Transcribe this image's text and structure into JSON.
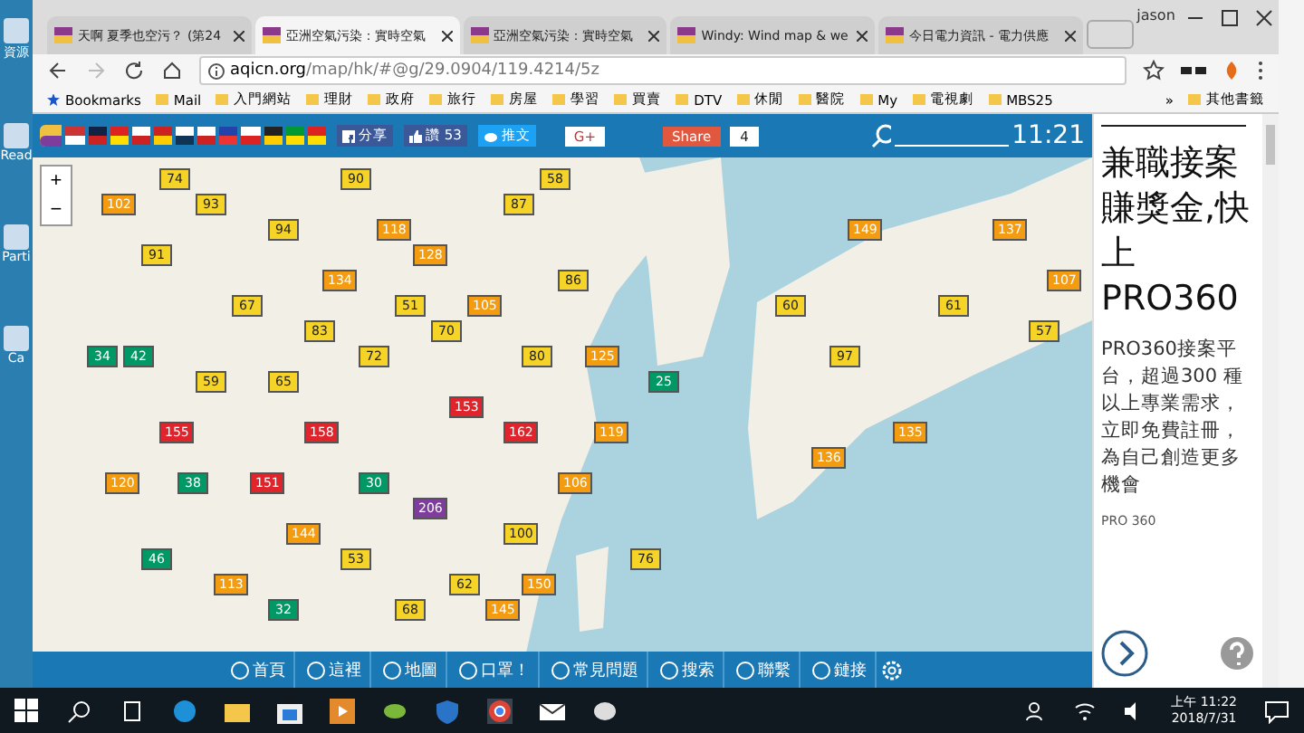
{
  "desktop": {
    "labels": [
      "資源",
      "Read",
      "Parti",
      "Ca"
    ]
  },
  "tabs": [
    {
      "title": "天啊 夏季也空污？ (第24",
      "selected": false
    },
    {
      "title": "亞洲空氣污染：實時空氣",
      "selected": true
    },
    {
      "title": "亞洲空氣污染：實時空氣",
      "selected": false
    },
    {
      "title": "Windy: Wind map & we",
      "selected": false
    },
    {
      "title": "今日電力資訊 - 電力供應",
      "selected": false
    }
  ],
  "user": "jason",
  "address": {
    "host": "aqicn.org",
    "path": "/map/hk/#@g/29.0904/119.4214/5z"
  },
  "bookmarks": [
    "Bookmarks",
    "Mail",
    "入門網站",
    "理財",
    "政府",
    "旅行",
    "房屋",
    "學習",
    "買賣",
    "DTV",
    "休閒",
    "醫院",
    "My",
    "電視劇",
    "MBS25"
  ],
  "bookmarks_more": "»",
  "other_bookmarks": "其他書籤",
  "map_header": {
    "share": "分享",
    "like": "讚 53",
    "tweet": "推文",
    "gplus": "G+",
    "share_button": "Share",
    "share_count": "4",
    "time": "11:21"
  },
  "map": {
    "zoom_in": "+",
    "zoom_out": "−",
    "markers": [
      {
        "value": "74",
        "color": "#f5d327"
      },
      {
        "value": "90",
        "color": "#f5d327"
      },
      {
        "value": "58",
        "color": "#f5d327"
      },
      {
        "value": "102",
        "color": "#f39c12"
      },
      {
        "value": "93",
        "color": "#f5d327"
      },
      {
        "value": "87",
        "color": "#f5d327"
      },
      {
        "value": "94",
        "color": "#f5d327"
      },
      {
        "value": "118",
        "color": "#f39c12"
      },
      {
        "value": "149",
        "color": "#f39c12"
      },
      {
        "value": "137",
        "color": "#f39c12"
      },
      {
        "value": "91",
        "color": "#f5d327"
      },
      {
        "value": "128",
        "color": "#f39c12"
      },
      {
        "value": "134",
        "color": "#f39c12"
      },
      {
        "value": "86",
        "color": "#f5d327"
      },
      {
        "value": "107",
        "color": "#f39c12"
      },
      {
        "value": "67",
        "color": "#f5d327"
      },
      {
        "value": "51",
        "color": "#f5d327"
      },
      {
        "value": "105",
        "color": "#f39c12"
      },
      {
        "value": "60",
        "color": "#f5d327"
      },
      {
        "value": "61",
        "color": "#f5d327"
      },
      {
        "value": "83",
        "color": "#f5d327"
      },
      {
        "value": "70",
        "color": "#f5d327"
      },
      {
        "value": "57",
        "color": "#f5d327"
      },
      {
        "value": "34",
        "color": "#009966"
      },
      {
        "value": "42",
        "color": "#009966"
      },
      {
        "value": "72",
        "color": "#f5d327"
      },
      {
        "value": "80",
        "color": "#f5d327"
      },
      {
        "value": "125",
        "color": "#f39c12"
      },
      {
        "value": "97",
        "color": "#f5d327"
      },
      {
        "value": "59",
        "color": "#f5d327"
      },
      {
        "value": "65",
        "color": "#f5d327"
      },
      {
        "value": "25",
        "color": "#009966"
      },
      {
        "value": "153",
        "color": "#e0242c"
      },
      {
        "value": "155",
        "color": "#e0242c"
      },
      {
        "value": "158",
        "color": "#e0242c"
      },
      {
        "value": "162",
        "color": "#e0242c"
      },
      {
        "value": "119",
        "color": "#f39c12"
      },
      {
        "value": "135",
        "color": "#f39c12"
      },
      {
        "value": "136",
        "color": "#f39c12"
      },
      {
        "value": "120",
        "color": "#f39c12"
      },
      {
        "value": "38",
        "color": "#009966"
      },
      {
        "value": "151",
        "color": "#e0242c"
      },
      {
        "value": "30",
        "color": "#009966"
      },
      {
        "value": "106",
        "color": "#f39c12"
      },
      {
        "value": "206",
        "color": "#7e3d9c"
      },
      {
        "value": "144",
        "color": "#f39c12"
      },
      {
        "value": "100",
        "color": "#f5d327"
      },
      {
        "value": "46",
        "color": "#009966"
      },
      {
        "value": "53",
        "color": "#f5d327"
      },
      {
        "value": "76",
        "color": "#f5d327"
      },
      {
        "value": "113",
        "color": "#f39c12"
      },
      {
        "value": "62",
        "color": "#f5d327"
      },
      {
        "value": "150",
        "color": "#f39c12"
      },
      {
        "value": "32",
        "color": "#009966"
      },
      {
        "value": "68",
        "color": "#f5d327"
      },
      {
        "value": "145",
        "color": "#f39c12"
      }
    ]
  },
  "ad": {
    "headline": "兼職接案賺獎金,快上PRO360",
    "body": "PRO360接案平台，超過300 種以上專業需求，立即免費註冊，為自己創造更多機會",
    "brand": "PRO 360"
  },
  "nav": [
    "首頁",
    "這裡",
    "地圖",
    "口罩！",
    "常見問題",
    "搜索",
    "聯繫",
    "鏈接"
  ],
  "taskbar": {
    "time": "上午 11:22",
    "date": "2018/7/31"
  }
}
